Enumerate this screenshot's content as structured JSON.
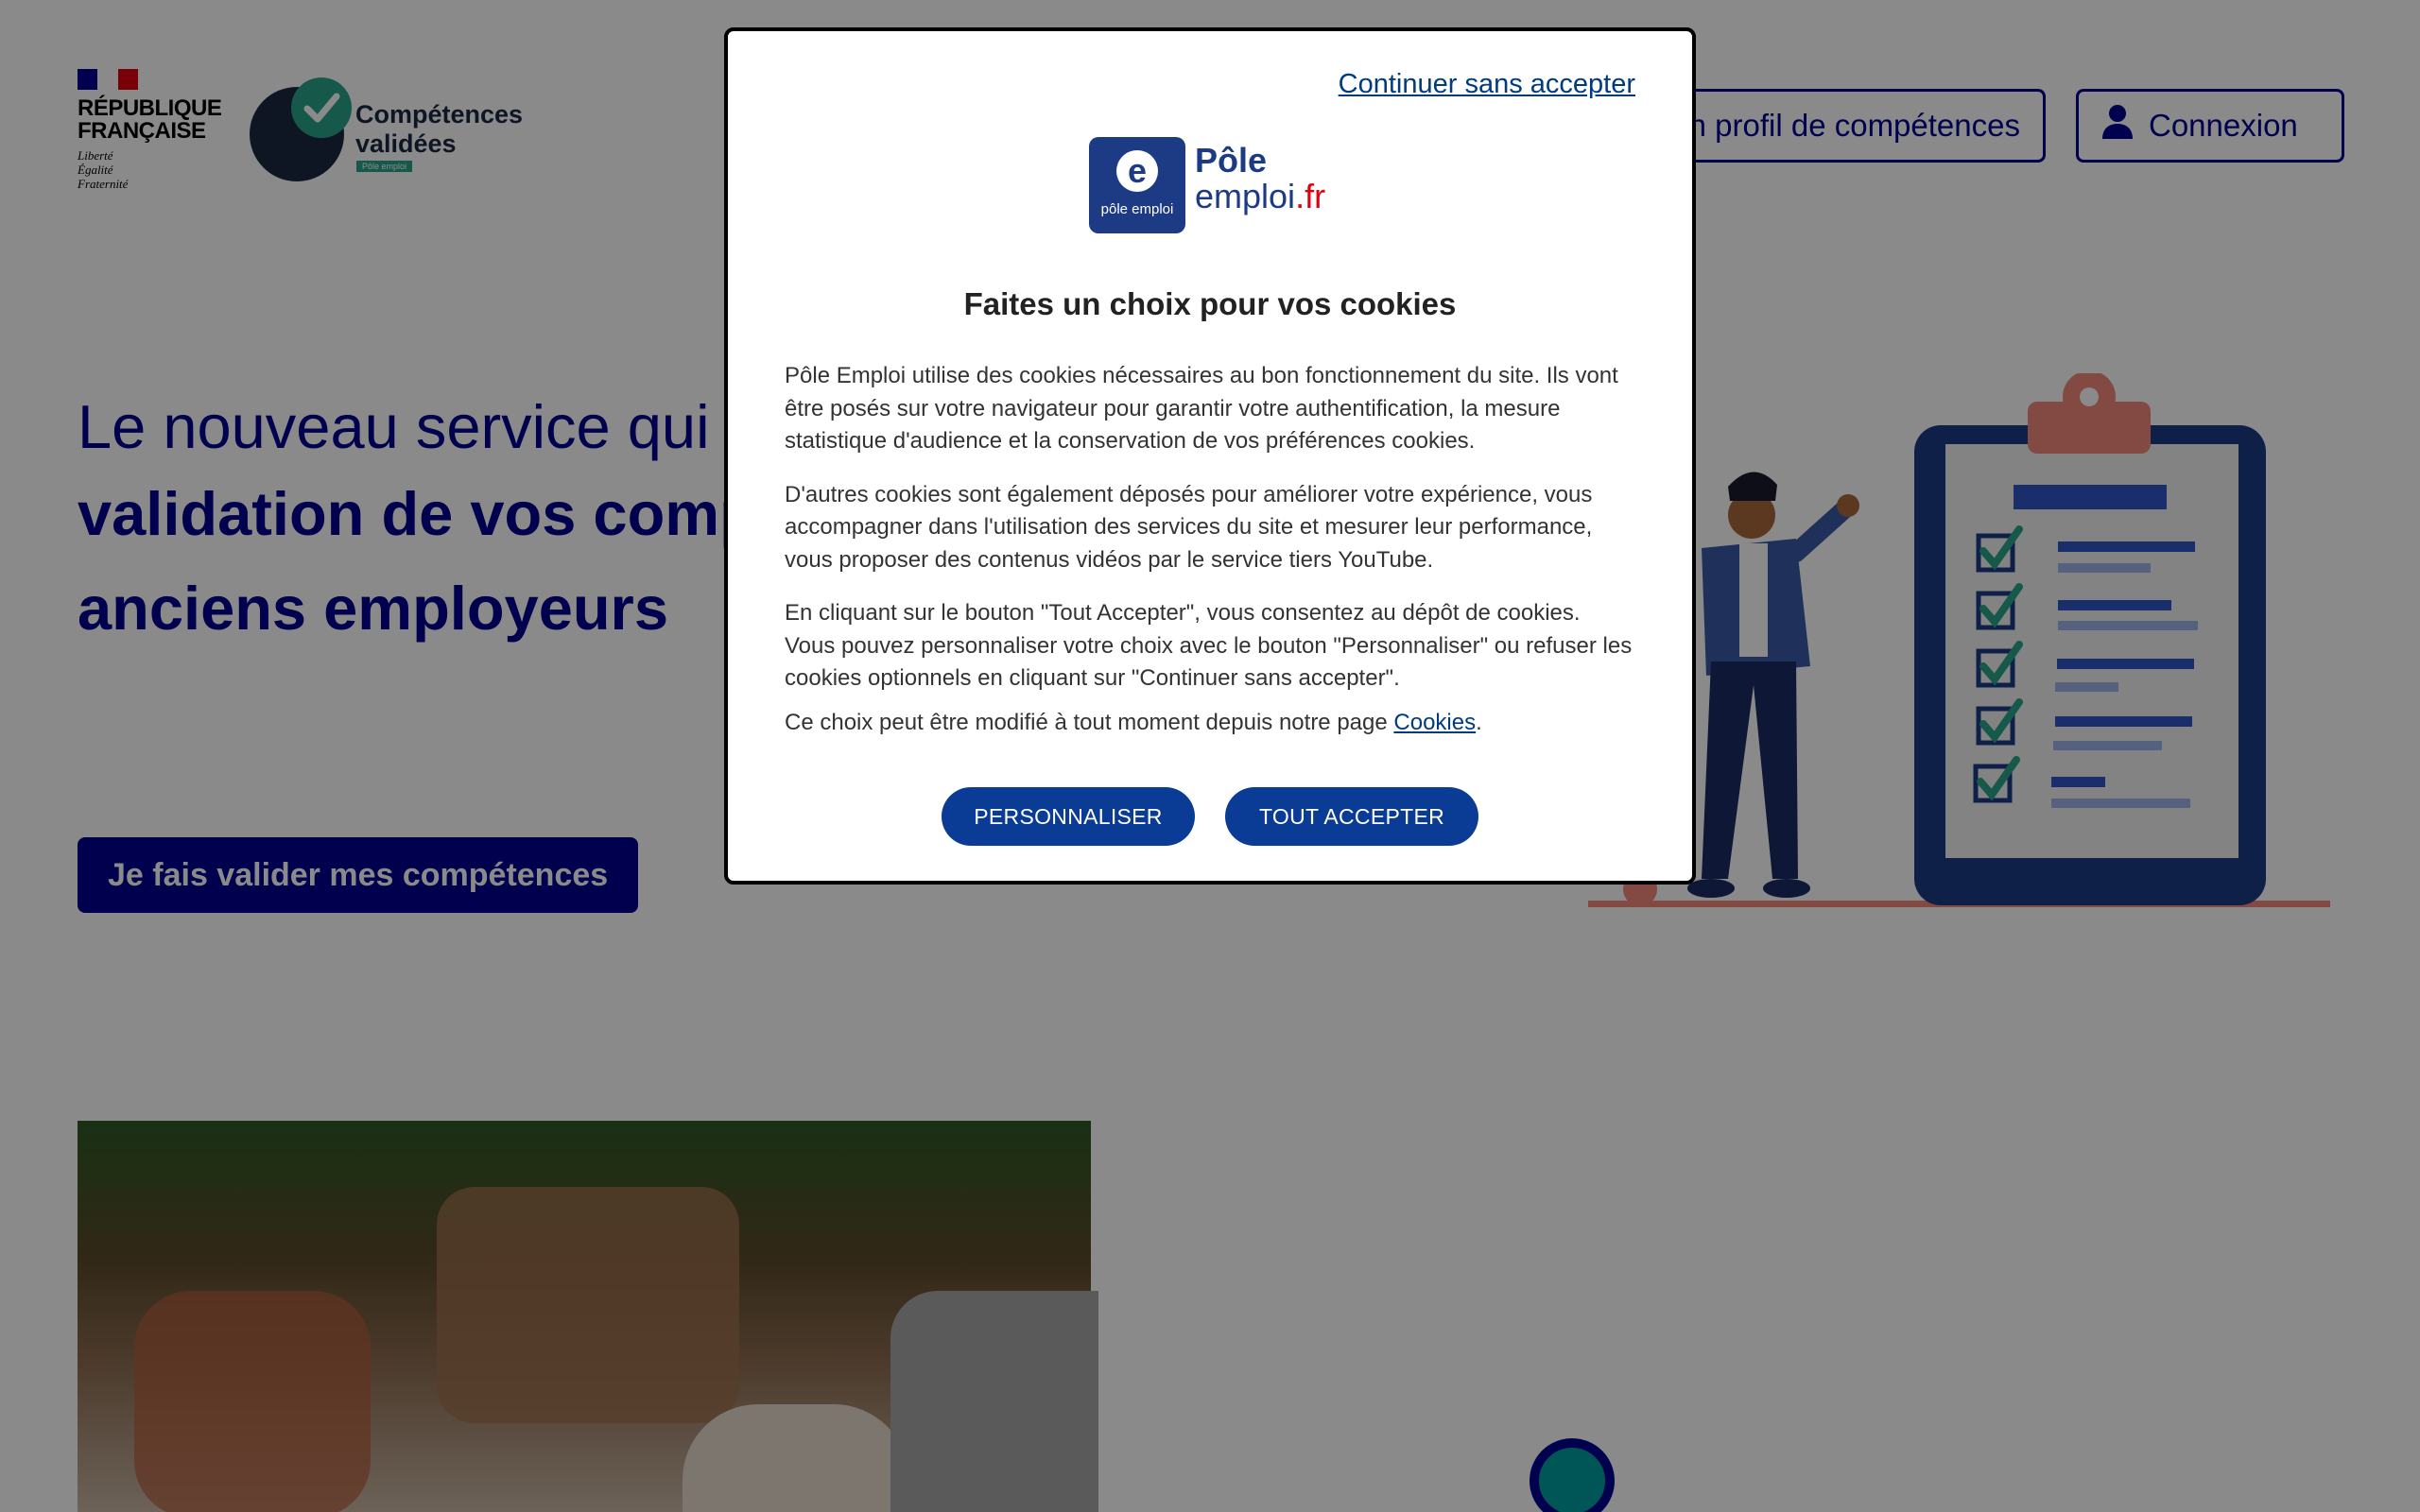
{
  "header": {
    "rf_name_line1": "RÉPUBLIQUE",
    "rf_name_line2": "FRANÇAISE",
    "rf_motto_1": "Liberté",
    "rf_motto_2": "Égalité",
    "rf_motto_3": "Fraternité",
    "cv_title_1": "Compétences",
    "cv_title_2": "validées",
    "cv_tag": "Pôle emploi",
    "profile_button": "Mon profil de compétences",
    "login_button": "Connexion"
  },
  "hero": {
    "line1": "Le nouveau service qui facilite la",
    "line2": "validation de vos compétences par vos",
    "line3": "anciens employeurs",
    "cta": "Je fais valider mes compétences"
  },
  "cookie_modal": {
    "continue_link": "Continuer sans accepter",
    "logo_brand_1": "Pôle",
    "logo_brand_2": "emploi",
    "logo_tld": ".fr",
    "logo_square_text": "pôle emploi",
    "logo_square_letter": "e",
    "title": "Faites un choix pour vos cookies",
    "paragraph_1": "Pôle Emploi utilise des cookies nécessaires au bon fonctionnement du site. Ils vont être posés sur votre navigateur pour garantir votre authentification, la mesure statistique d'audience et la conservation de vos préférences cookies.",
    "paragraph_2": "D'autres cookies sont également déposés pour améliorer votre expérience, vous accompagner dans l'utilisation des services du site et mesurer leur performance, vous proposer des contenus vidéos par le service tiers YouTube.",
    "paragraph_3": "En cliquant sur le bouton \"Tout Accepter\", vous consentez au dépôt de cookies. Vous pouvez personnaliser votre choix avec le bouton \"Personnaliser\" ou refuser les cookies optionnels en cliquant sur \"Continuer sans accepter\".",
    "paragraph_4_prefix": "Ce choix peut être modifié à tout moment depuis notre page ",
    "paragraph_4_link": "Cookies",
    "paragraph_4_suffix": ".",
    "btn_customize": "PERSONNALISER",
    "btn_accept_all": "TOUT ACCEPTER"
  },
  "colors": {
    "primary_blue": "#000091",
    "teal": "#2aa58a",
    "overlay": "rgba(0,0,0,0.46)",
    "modal_button": "#0b3c95"
  }
}
